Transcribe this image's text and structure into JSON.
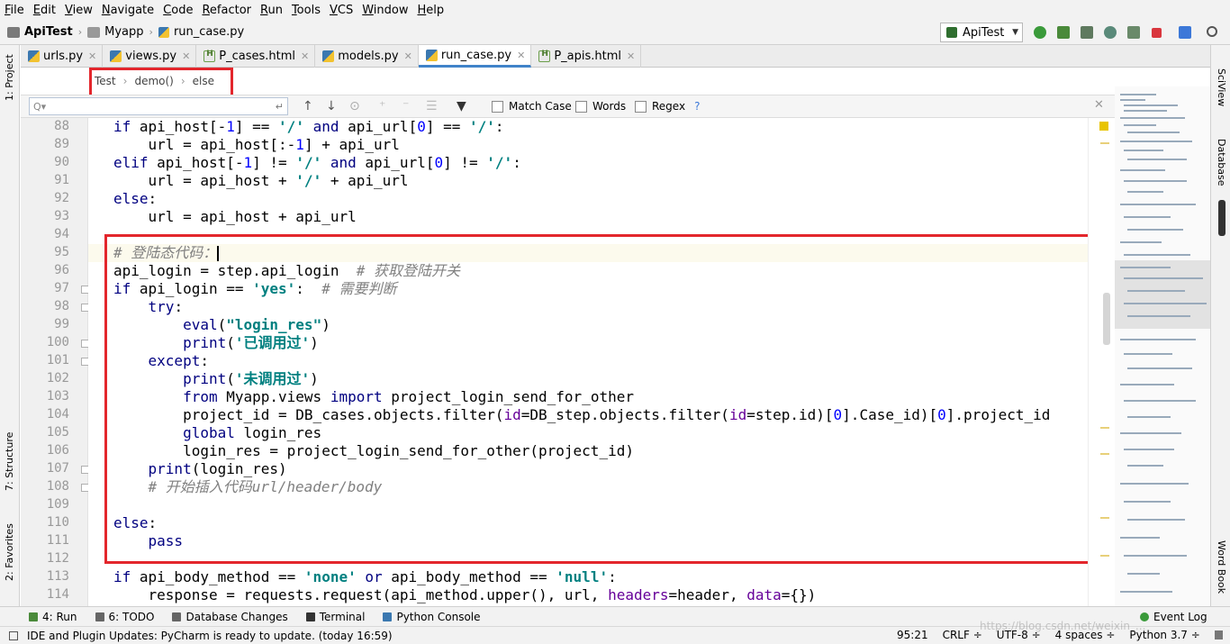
{
  "menu": [
    "File",
    "Edit",
    "View",
    "Navigate",
    "Code",
    "Refactor",
    "Run",
    "Tools",
    "VCS",
    "Window",
    "Help"
  ],
  "nav": {
    "project": "ApiTest",
    "folder": "Myapp",
    "file": "run_case.py",
    "run_config": "ApiTest"
  },
  "tabs": [
    {
      "label": "urls.py",
      "type": "py"
    },
    {
      "label": "views.py",
      "type": "py"
    },
    {
      "label": "P_cases.html",
      "type": "html"
    },
    {
      "label": "models.py",
      "type": "py"
    },
    {
      "label": "run_case.py",
      "type": "py"
    },
    {
      "label": "P_apis.html",
      "type": "html"
    }
  ],
  "active_tab": "run_case.py",
  "breadcrumb": [
    "Test",
    "demo()",
    "else"
  ],
  "search": {
    "placeholder": "Q▾",
    "match_case": "Match Case",
    "words": "Words",
    "regex": "Regex",
    "help": "?"
  },
  "side_left": {
    "project": "1: Project",
    "structure": "7: Structure",
    "favorites": "2: Favorites"
  },
  "side_right": {
    "sciview": "SciView",
    "database": "Database",
    "wordbook": "Word Book"
  },
  "line_numbers": [
    "88",
    "89",
    "90",
    "91",
    "92",
    "93",
    "94",
    "95",
    "96",
    "97",
    "98",
    "99",
    "100",
    "101",
    "102",
    "103",
    "104",
    "105",
    "106",
    "107",
    "108",
    "109",
    "110",
    "111",
    "112",
    "113",
    "114"
  ],
  "bottom_tools": {
    "run": "4: Run",
    "todo": "6: TODO",
    "db_changes": "Database Changes",
    "terminal": "Terminal",
    "console": "Python Console",
    "event_log": "Event Log"
  },
  "status": {
    "message": "IDE and Plugin Updates: PyCharm is ready to update. (today 16:59)",
    "position": "95:21",
    "line_sep": "CRLF ÷",
    "encoding": "UTF-8 ÷",
    "indent": "4 spaces ÷",
    "interpreter": "Python 3.7 ÷"
  },
  "watermark": "https://blog.csdn.net/weixin_..."
}
